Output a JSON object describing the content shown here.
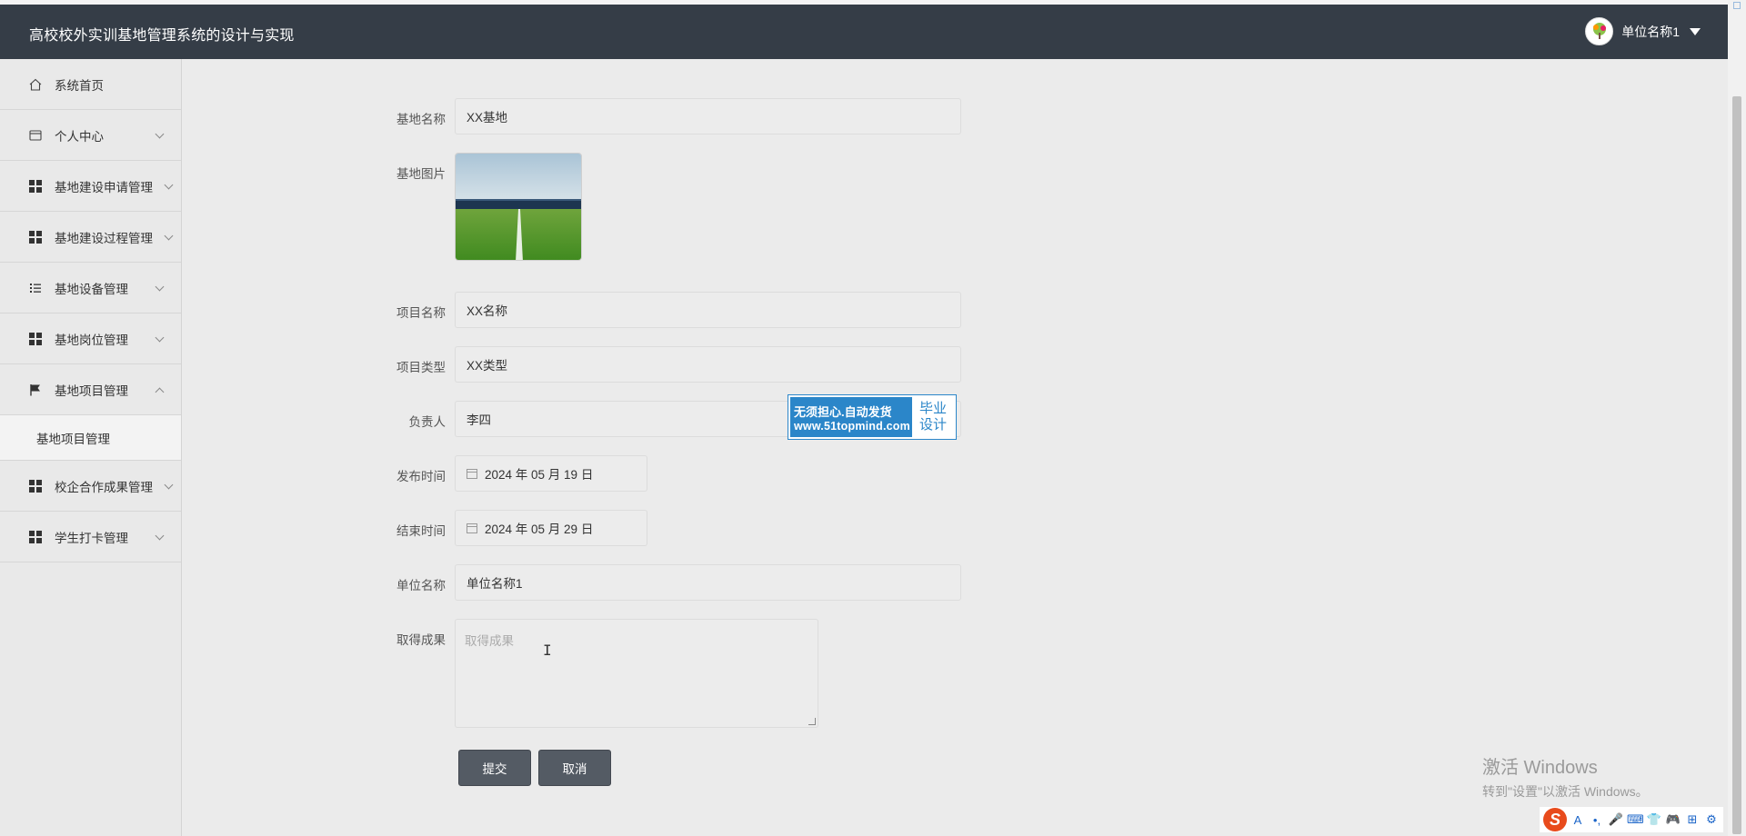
{
  "header": {
    "title": "高校校外实训基地管理系统的设计与实现",
    "user_name": "单位名称1"
  },
  "sidebar": {
    "items": [
      {
        "label": "系统首页",
        "icon": "home-icon"
      },
      {
        "label": "个人中心",
        "icon": "card-icon"
      },
      {
        "label": "基地建设申请管理",
        "icon": "grid-icon"
      },
      {
        "label": "基地建设过程管理",
        "icon": "grid-icon"
      },
      {
        "label": "基地设备管理",
        "icon": "list-icon"
      },
      {
        "label": "基地岗位管理",
        "icon": "grid-icon"
      },
      {
        "label": "基地项目管理",
        "icon": "flag-icon"
      },
      {
        "label": "校企合作成果管理",
        "icon": "grid-icon"
      },
      {
        "label": "学生打卡管理",
        "icon": "grid-icon"
      }
    ],
    "submenu": {
      "label": "基地项目管理"
    }
  },
  "form": {
    "base_name": {
      "label": "基地名称",
      "value": "XX基地"
    },
    "base_image": {
      "label": "基地图片"
    },
    "project_name": {
      "label": "项目名称",
      "value": "XX名称"
    },
    "project_type": {
      "label": "项目类型",
      "value": "XX类型"
    },
    "manager": {
      "label": "负责人",
      "value": "李四"
    },
    "publish_time": {
      "label": "发布时间",
      "value": "2024 年 05 月 19 日"
    },
    "end_time": {
      "label": "结束时间",
      "value": "2024 年 05 月 29 日"
    },
    "unit_name": {
      "label": "单位名称",
      "value": "单位名称1"
    },
    "achievement": {
      "label": "取得成果",
      "placeholder": "取得成果",
      "value": ""
    },
    "submit_label": "提交",
    "cancel_label": "取消"
  },
  "overlay_badge": {
    "line1": "无须担心.自动发货",
    "line2": "www.51topmind.com",
    "right1": "毕业",
    "right2": "设计"
  },
  "os_watermark": {
    "line1": "激活 Windows",
    "line2": "转到\"设置\"以激活 Windows。"
  },
  "taskbar": {
    "ime_logo": "S",
    "ime_mode": "A"
  },
  "colors": {
    "header_bg": "#353d47",
    "sidebar_bg": "#e9e9e9",
    "page_bg": "#ebebeb",
    "button_bg": "#545b64",
    "badge_blue": "#2b86c9"
  }
}
